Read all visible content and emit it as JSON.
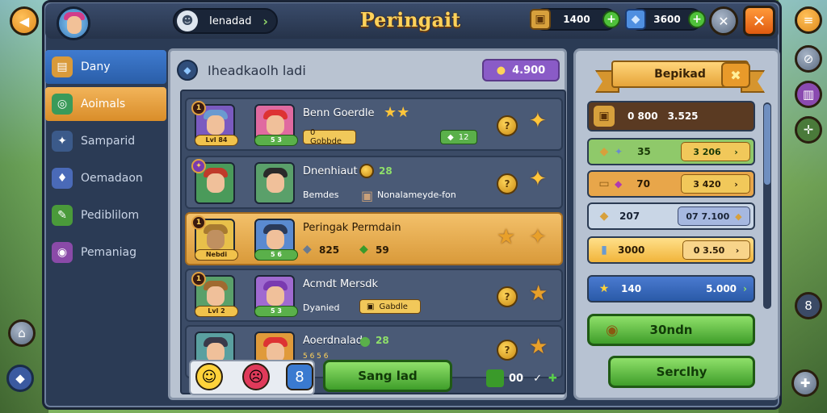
{
  "header": {
    "title": "Peringait",
    "search_label": "Ienadad",
    "resources": [
      {
        "name": "gold",
        "value": "1400"
      },
      {
        "name": "gems",
        "value": "3600"
      }
    ]
  },
  "sidebar": {
    "items": [
      {
        "label": "Dany",
        "icon": "map-icon"
      },
      {
        "label": "Aoimals",
        "icon": "animal-icon"
      },
      {
        "label": "Samparid",
        "icon": "star-icon"
      },
      {
        "label": "Oemadaon",
        "icon": "potion-icon"
      },
      {
        "label": "Pediblilom",
        "icon": "scroll-icon"
      },
      {
        "label": "Pemaniag",
        "icon": "spell-icon"
      }
    ]
  },
  "main": {
    "title": "Iheadkaolh ladi",
    "pill_value": "4.900",
    "rows": [
      {
        "name": "Benn Goerdle",
        "level": "Lvl 84",
        "count": "5 3",
        "tag": "0 Gobbde",
        "reward": "12"
      },
      {
        "name": "Dnenhiaut",
        "sub": "Bemdes",
        "gain": "28",
        "note": "Nonalameyde-fon"
      },
      {
        "name": "Peringak Permdain",
        "level": "Nebdi",
        "count": "5 6",
        "stat": "825",
        "reward": "59"
      },
      {
        "name": "Acmdt Mersdk",
        "level": "Lvl 2",
        "count": "5 3",
        "sub": "Dyanied",
        "tag": "Gabdle"
      },
      {
        "name": "Aoerdnalad",
        "gain": "28",
        "tag": "5 6 5 6"
      }
    ]
  },
  "bottom": {
    "button_label": "Sang lad",
    "count": "00"
  },
  "right_panel": {
    "banner_title": "Bepikad",
    "rows": [
      {
        "left": "0 800",
        "right": "3.525"
      },
      {
        "left": "35",
        "right": "3 206"
      },
      {
        "left": "70",
        "right": "3 420"
      },
      {
        "left": "207",
        "right": "07 7.100"
      },
      {
        "left": "3000",
        "right": "0 3.50"
      },
      {
        "left": "140",
        "right": "5.000"
      }
    ],
    "button_primary": "30ndn",
    "button_secondary": "Serclhy"
  }
}
